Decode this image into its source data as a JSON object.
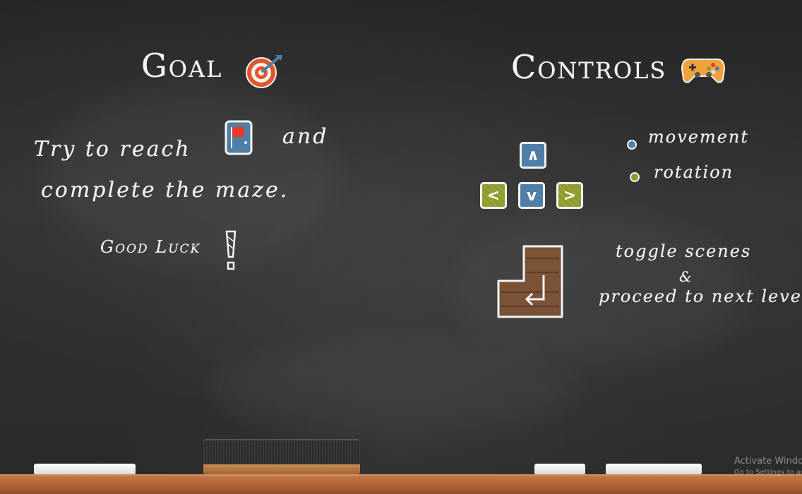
{
  "goal": {
    "title": "Goal",
    "title_icon": "target-icon",
    "line1_before": "Try to reach",
    "line1_icon": "exit-door-flag-icon",
    "line1_after": "and",
    "line2": "complete the maze.",
    "luck": "Good Luck"
  },
  "controls": {
    "title": "Controls",
    "title_icon": "gamepad-icon",
    "keys": {
      "up": "∧",
      "left": "<",
      "down": "v",
      "right": ">"
    },
    "legend": [
      {
        "label": "movement",
        "color": "#4f7ea6"
      },
      {
        "label": "rotation",
        "color": "#8e9a2b"
      }
    ],
    "enter_key_icon": "enter-key-icon",
    "enter_line1": "toggle scenes",
    "enter_amp": "&",
    "enter_line2": "proceed to next level"
  },
  "watermark": {
    "line1": "Activate Windo",
    "line2": "Go to Settings to ac"
  },
  "colors": {
    "movement": "#4f7ea6",
    "rotation": "#8e9a2b",
    "wood": "#7a5236",
    "ledge": "#b06638"
  }
}
